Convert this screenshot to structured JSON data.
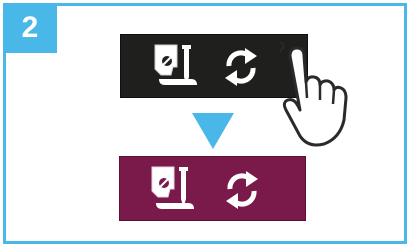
{
  "step": {
    "number": "2"
  },
  "colors": {
    "accent": "#49b8e8",
    "panel_default": "#1f1f1e",
    "panel_active": "#7a1a4a"
  },
  "panels": [
    {
      "state": "default",
      "icons": [
        "presser-foot-icon",
        "thread-rotate-icon"
      ]
    },
    {
      "state": "active",
      "icons": [
        "presser-foot-icon",
        "thread-rotate-icon"
      ]
    }
  ],
  "indicators": {
    "arrow": "down-arrow-icon",
    "pointer": "tapping-hand-icon"
  }
}
